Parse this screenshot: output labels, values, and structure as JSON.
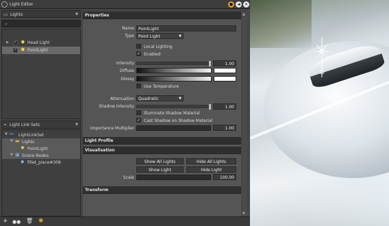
{
  "window": {
    "title": "Light Editor",
    "btn_min": "●",
    "btn_opt": "◄",
    "btn_close": "✕"
  },
  "lights_panel": {
    "dropdown_label": "Lights",
    "items": [
      {
        "label": "Head Light",
        "checked": true
      },
      {
        "label": "PointLight",
        "checked": true,
        "selected": true
      }
    ]
  },
  "linksets_panel": {
    "header": "Light Link Sets",
    "nodes": [
      {
        "label": "LightLinkSet",
        "level": 0
      },
      {
        "label": "Lights",
        "level": 1
      },
      {
        "label": "PointLight",
        "level": 2
      },
      {
        "label": "Scene Nodes",
        "level": 1
      },
      {
        "label": "fillet_piece#308",
        "level": 2
      }
    ]
  },
  "properties": {
    "section_title": "Properties",
    "name_label": "Name",
    "name_value": "PointLight",
    "type_label": "Type",
    "type_value": "Point Light",
    "local_lighting": "Local Lighting",
    "enabled": "Enabled",
    "intensity_label": "Intensity",
    "intensity_value": "1.00",
    "diffuse_label": "Diffuse",
    "glossy_label": "Glossy",
    "use_temperature": "Use Temperature",
    "attenuation_label": "Attenuation",
    "attenuation_value": "Quadratic",
    "shadow_intensity_label": "Shadow Intensity",
    "shadow_intensity_value": "1.00",
    "illuminate_shadow": "Illuminate Shadow Material",
    "cast_shadow": "Cast Shadow on Shadow Material",
    "importance_label": "Importance Multiplier",
    "importance_value": "1.00"
  },
  "light_profile": {
    "title": "Light Profile"
  },
  "visualisation": {
    "title": "Visualisation",
    "show_all": "Show All Lights",
    "hide_all": "Hide All Lights",
    "show_light": "Show Light",
    "hide_light": "Hide Light",
    "scale_label": "Scale",
    "scale_value": "100.00"
  },
  "transform": {
    "title": "Transform"
  },
  "toolbar": {
    "add": "+",
    "link": "●●",
    "delete": "🗑",
    "bulb": "✺"
  },
  "colors": {
    "accent_orange": "#e8a21a",
    "diffuse_color": "#ffffff",
    "glossy_color": "#ffffff"
  }
}
